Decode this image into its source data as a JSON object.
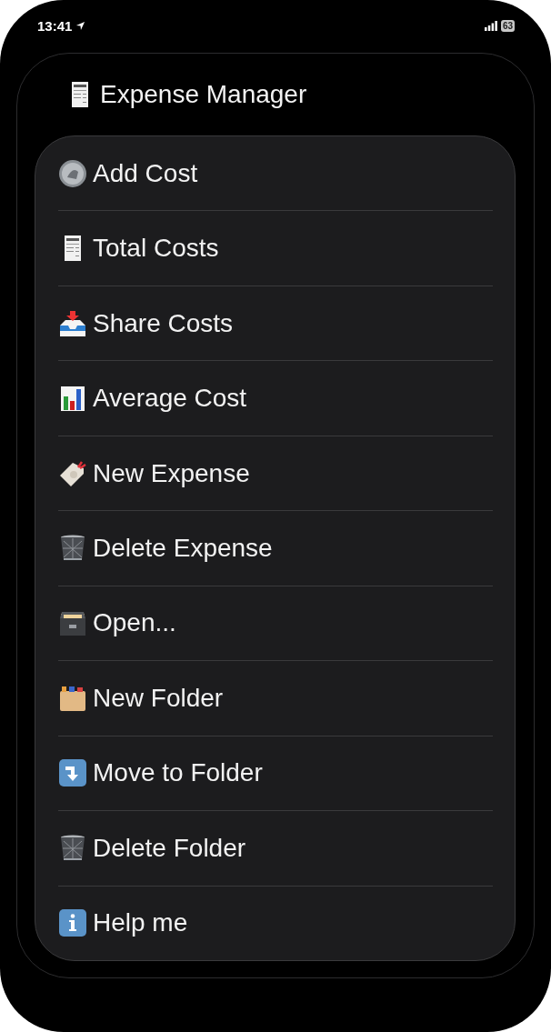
{
  "status_bar": {
    "time": "13:41",
    "battery": "63"
  },
  "title": {
    "text": "Expense Manager"
  },
  "menu": [
    {
      "kind": "coin",
      "label": "Add Cost"
    },
    {
      "kind": "receipt",
      "label": "Total Costs"
    },
    {
      "kind": "inbox",
      "label": "Share Costs"
    },
    {
      "kind": "chart",
      "label": "Average Cost"
    },
    {
      "kind": "tag",
      "label": "New Expense"
    },
    {
      "kind": "trash",
      "label": "Delete Expense"
    },
    {
      "kind": "cabinet",
      "label": "Open..."
    },
    {
      "kind": "dividers",
      "label": "New Folder"
    },
    {
      "kind": "arrow",
      "label": "Move to Folder"
    },
    {
      "kind": "trash",
      "label": "Delete Folder"
    },
    {
      "kind": "info",
      "label": "Help me"
    }
  ]
}
